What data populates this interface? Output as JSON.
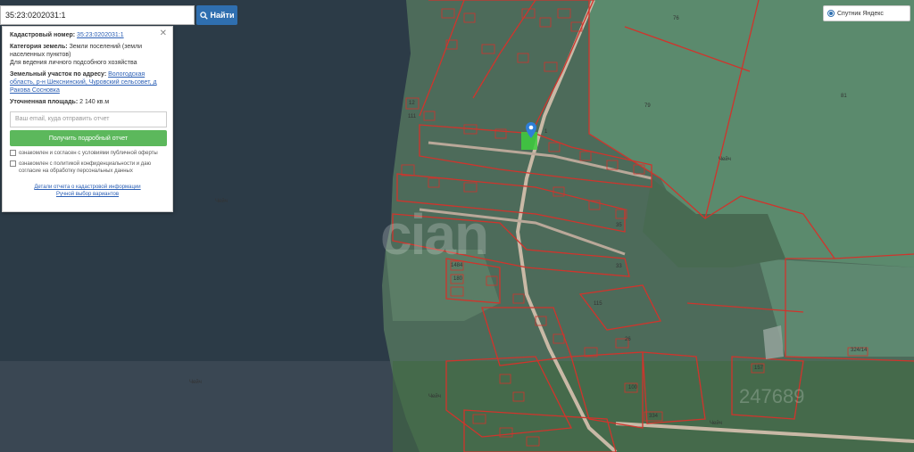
{
  "search": {
    "value": "35:23:0202031:1",
    "button_label": "Найти"
  },
  "panel": {
    "cadastral_label": "Кадастровый номер:",
    "cadastral_value": "35:23:0202031:1",
    "category_label": "Категория земель:",
    "category_value": "Земли поселений (земли населенных пунктов)",
    "usage": "Для ведения личного подсобного хозяйства",
    "address_label": "Земельный участок по адресу:",
    "address_value": "Вологодская область, р-н Шекснинский, Чуровский сельсовет, д Ракова Сосновка",
    "area_label": "Уточненная площадь:",
    "area_value": "2 140 кв.м",
    "email_placeholder": "Ваш email, куда отправить отчет",
    "get_report_button": "Получить подробный отчет",
    "consent_1": "ознакомлен и согласен с условиями публичной оферты",
    "consent_2": "ознакомлен с политикой конфиденциальности и даю согласие на обработку персональных данных",
    "link_details": "Детали отчета о кадастровой информации",
    "link_manual": "Ручной выбор вариантов"
  },
  "layer_selector": {
    "label": "Спутник Яндекс"
  },
  "map_labels": [
    {
      "text": "76"
    },
    {
      "text": "81"
    },
    {
      "text": "79"
    },
    {
      "text": "Чейч"
    },
    {
      "text": "Чейч"
    },
    {
      "text": "Чейч"
    },
    {
      "text": "Чейч"
    },
    {
      "text": "Чейч"
    },
    {
      "text": "33"
    },
    {
      "text": "26"
    },
    {
      "text": "115"
    },
    {
      "text": "157"
    },
    {
      "text": "100"
    },
    {
      "text": "334"
    },
    {
      "text": "1484"
    },
    {
      "text": "180"
    },
    {
      "text": "12"
    },
    {
      "text": "111"
    },
    {
      "text": "35"
    },
    {
      "text": "1"
    },
    {
      "text": "324/14"
    }
  ],
  "watermark": "cian",
  "watermark_sub": "247689",
  "colors": {
    "water": "#2c3b47",
    "land": "#4d6b5a",
    "field": "#5f8a6e",
    "parcel_line": "#d0342c",
    "search_button": "#2f6fb0",
    "report_button": "#5cb85c"
  }
}
